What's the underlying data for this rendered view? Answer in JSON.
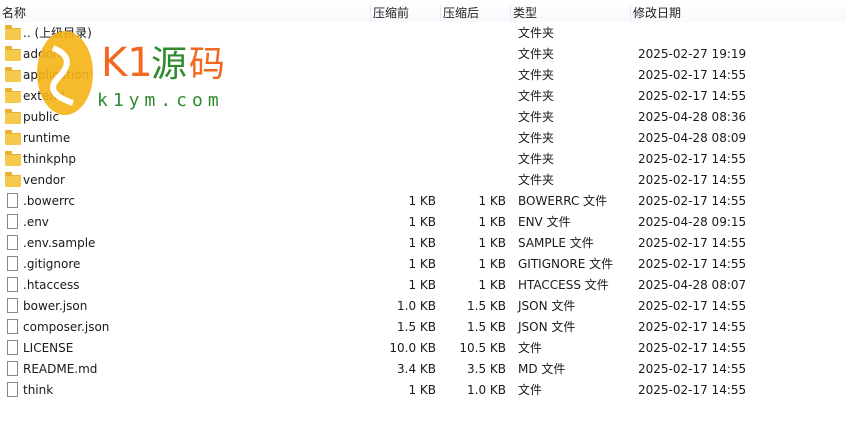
{
  "columns": {
    "name": "名称",
    "before": "压缩前",
    "after": "压缩后",
    "type": "类型",
    "date": "修改日期"
  },
  "watermark": "K1源码 k1ym.com",
  "rows": [
    {
      "icon": "folder-icon",
      "name": ".. (上级目录)",
      "before": "",
      "after": "",
      "type": "文件夹",
      "date": ""
    },
    {
      "icon": "folder-icon",
      "name": "addons",
      "before": "",
      "after": "",
      "type": "文件夹",
      "date": "2025-02-27 19:19"
    },
    {
      "icon": "folder-icon",
      "name": "application",
      "before": "",
      "after": "",
      "type": "文件夹",
      "date": "2025-02-17 14:55"
    },
    {
      "icon": "folder-icon",
      "name": "extend",
      "before": "",
      "after": "",
      "type": "文件夹",
      "date": "2025-02-17 14:55"
    },
    {
      "icon": "folder-icon",
      "name": "public",
      "before": "",
      "after": "",
      "type": "文件夹",
      "date": "2025-04-28 08:36"
    },
    {
      "icon": "folder-icon",
      "name": "runtime",
      "before": "",
      "after": "",
      "type": "文件夹",
      "date": "2025-04-28 08:09"
    },
    {
      "icon": "folder-icon",
      "name": "thinkphp",
      "before": "",
      "after": "",
      "type": "文件夹",
      "date": "2025-02-17 14:55"
    },
    {
      "icon": "folder-icon",
      "name": "vendor",
      "before": "",
      "after": "",
      "type": "文件夹",
      "date": "2025-02-17 14:55"
    },
    {
      "icon": "file-icon",
      "name": ".bowerrc",
      "before": "1 KB",
      "after": "1 KB",
      "type": "BOWERRC 文件",
      "date": "2025-02-17 14:55"
    },
    {
      "icon": "file-icon",
      "name": ".env",
      "before": "1 KB",
      "after": "1 KB",
      "type": "ENV 文件",
      "date": "2025-04-28 09:15"
    },
    {
      "icon": "file-icon",
      "name": ".env.sample",
      "before": "1 KB",
      "after": "1 KB",
      "type": "SAMPLE 文件",
      "date": "2025-02-17 14:55"
    },
    {
      "icon": "file-icon",
      "name": ".gitignore",
      "before": "1 KB",
      "after": "1 KB",
      "type": "GITIGNORE 文件",
      "date": "2025-02-17 14:55"
    },
    {
      "icon": "file-icon",
      "name": ".htaccess",
      "before": "1 KB",
      "after": "1 KB",
      "type": "HTACCESS 文件",
      "date": "2025-04-28 08:07"
    },
    {
      "icon": "file-icon",
      "name": "bower.json",
      "before": "1.0 KB",
      "after": "1.5 KB",
      "type": "JSON 文件",
      "date": "2025-02-17 14:55"
    },
    {
      "icon": "file-icon",
      "name": "composer.json",
      "before": "1.5 KB",
      "after": "1.5 KB",
      "type": "JSON 文件",
      "date": "2025-02-17 14:55"
    },
    {
      "icon": "file-icon",
      "name": "LICENSE",
      "before": "10.0 KB",
      "after": "10.5 KB",
      "type": "文件",
      "date": "2025-02-17 14:55"
    },
    {
      "icon": "file-icon",
      "name": "README.md",
      "before": "3.4 KB",
      "after": "3.5 KB",
      "type": "MD 文件",
      "date": "2025-02-17 14:55"
    },
    {
      "icon": "file-icon",
      "name": "think",
      "before": "1 KB",
      "after": "1.0 KB",
      "type": "文件",
      "date": "2025-02-17 14:55"
    }
  ]
}
